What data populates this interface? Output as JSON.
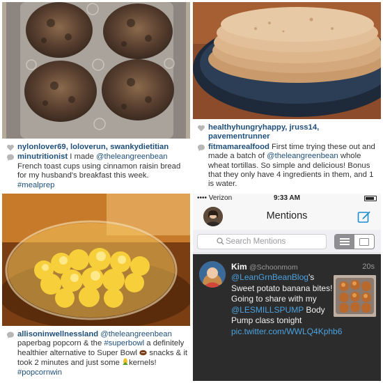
{
  "panel1": {
    "likes": "nylonlover69, loloverun, swankydietitian",
    "user": "minutritionist",
    "text_before": " I made ",
    "mention": "@theleangreenbean",
    "text_after": " French toast cups using cinnamon raisin bread for my husband's breakfast this week.",
    "hashtag": "#mealprep"
  },
  "panel2": {
    "likes": "healthyhungryhappy, jruss14, pavementrunner",
    "user": "fitmamarealfood",
    "text_before": " First time trying these out and made a batch of ",
    "mention": "@theleangreenbean",
    "text_after": " whole wheat tortillas. So simple and delicious! Bonus that they only have 4 ingredients in them, and 1 is water."
  },
  "panel3": {
    "user": "allisoninwellnessland",
    "mention": "@theleangreenbean",
    "text_1": " paperbag popcorn & the ",
    "hashtag_1": "#superbowl",
    "text_2": " a definitely healthier alternative to Super Bowl ",
    "text_3": " snacks & it took 2 minutes and just some ",
    "text_4": "kernels! ",
    "hashtag_2": "#popcornwin"
  },
  "twitter": {
    "carrier": "•••• Verizon",
    "time": "9:33 AM",
    "title": "Mentions",
    "search_placeholder": "Search Mentions",
    "tweet": {
      "name": "Kim",
      "handle": "@Schoonmom",
      "age": "20s",
      "mention": "@LeanGrnBeanBlog",
      "text_1": "'s Sweet potato banana bites! Going to share with my ",
      "mention_2": "@LESMILLSPUMP",
      "text_2": " Body Pump class tonight ",
      "link": "pic.twitter.com/WWLQ4Kphb6"
    }
  },
  "colors": {
    "link_blue": "#1f4f7a",
    "twitter_link": "#4ba3e0",
    "compose_blue": "#1a8ccf",
    "tweet_bg": "#2c2c2c"
  },
  "icons": [
    "heart-icon",
    "comment-icon",
    "search-icon",
    "compose-icon",
    "list-view-icon",
    "grid-view-icon",
    "football-icon",
    "corn-icon"
  ]
}
